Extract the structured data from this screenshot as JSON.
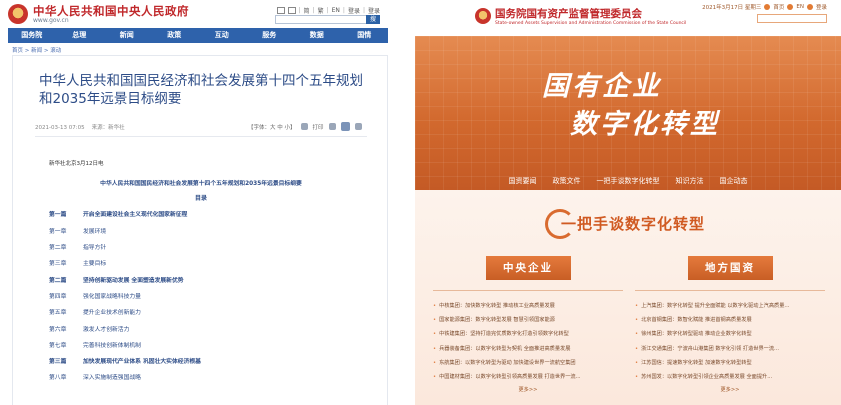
{
  "left": {
    "site_title": "中华人民共和国中央人民政府",
    "site_url": "www.gov.cn",
    "util_links": [
      "简",
      "繁",
      "EN",
      "登录",
      "登录"
    ],
    "search_btn": "搜",
    "nav": [
      "国务院",
      "总理",
      "新闻",
      "政策",
      "互动",
      "服务",
      "数据",
      "国情"
    ],
    "breadcrumb": "首页 > 新闻 > 滚动",
    "headline": "中华人民共和国国民经济和社会发展第十四个五年规划和2035年远景目标纲要",
    "meta_date": "2021-03-13 07:05",
    "meta_source": "来源：新华社",
    "font_size_label": "【字体：大 中 小】",
    "print_label": "打印",
    "dateline": "新华社北京3月12日电",
    "subtitle": "中华人民共和国国民经济和社会发展第十四个五年规划和2035年远景目标纲要",
    "toc_label": "目录",
    "toc": [
      {
        "num": "第一篇",
        "title": "开启全面建设社会主义现代化国家新征程",
        "part": true
      },
      {
        "num": "第一章",
        "title": "发展环境",
        "part": false
      },
      {
        "num": "第二章",
        "title": "指导方针",
        "part": false
      },
      {
        "num": "第三章",
        "title": "主要目标",
        "part": false
      },
      {
        "num": "第二篇",
        "title": "坚持创新驱动发展 全面塑造发展新优势",
        "part": true
      },
      {
        "num": "第四章",
        "title": "强化国家战略科技力量",
        "part": false
      },
      {
        "num": "第五章",
        "title": "提升企业技术创新能力",
        "part": false
      },
      {
        "num": "第六章",
        "title": "激发人才创新活力",
        "part": false
      },
      {
        "num": "第七章",
        "title": "完善科技创新体制机制",
        "part": false
      },
      {
        "num": "第三篇",
        "title": "加快发展现代产业体系 巩固壮大实体经济根基",
        "part": true
      },
      {
        "num": "第八章",
        "title": "深入实施制造强国战略",
        "part": false
      }
    ]
  },
  "right": {
    "org_title": "国务院国有资产监督管理委员会",
    "org_sub": "State-owned Assets Supervision and Administration Commission of the State Council",
    "header_util": [
      "2021年3月17日 星期三",
      "首页",
      "EN",
      "登录"
    ],
    "hero_line1": "国有企业",
    "hero_line2": "数字化转型",
    "hero_menu": [
      "国资要闻",
      "政策文件",
      "一把手谈数字化转型",
      "知识方法",
      "国企动态"
    ],
    "banner": "一把手谈数字化转型",
    "central": {
      "title": "中央企业",
      "items": [
        "中核集团：加快数字化转型 推动核工业高质量发展",
        "国家能源集团：数字化转型发展 智慧引领国家能源",
        "中铁建集团：坚持打造完优质数字化打造引领数字化转型",
        "兵器装备集团：以数字化转型为契机 全面推进高质量发展",
        "东航集团：以数字化转型为驱动 加快建设世界一流航空集团",
        "中国建材集团：以数字化转型引领高质量发展 打造世界一流..."
      ],
      "more": "更多>>"
    },
    "local": {
      "title": "地方国资",
      "items": [
        "上汽集团：数字化转型 提升全面赋能 以数字化驱动上汽高质量...",
        "北京首钢集团：数智化赋能 推进首钢高质量发展",
        "徐州集团：数字化转型驱动 推动企业数字化转型",
        "浙江交通集团：宁波舟山港集团 数字化引领 打造世界一流...",
        "江苏国信：提速数字化转型 加速数字化转型转型",
        "苏州国发：以数字化转型引领企业高质量发展 全面提升..."
      ],
      "more": "更多>>"
    }
  }
}
